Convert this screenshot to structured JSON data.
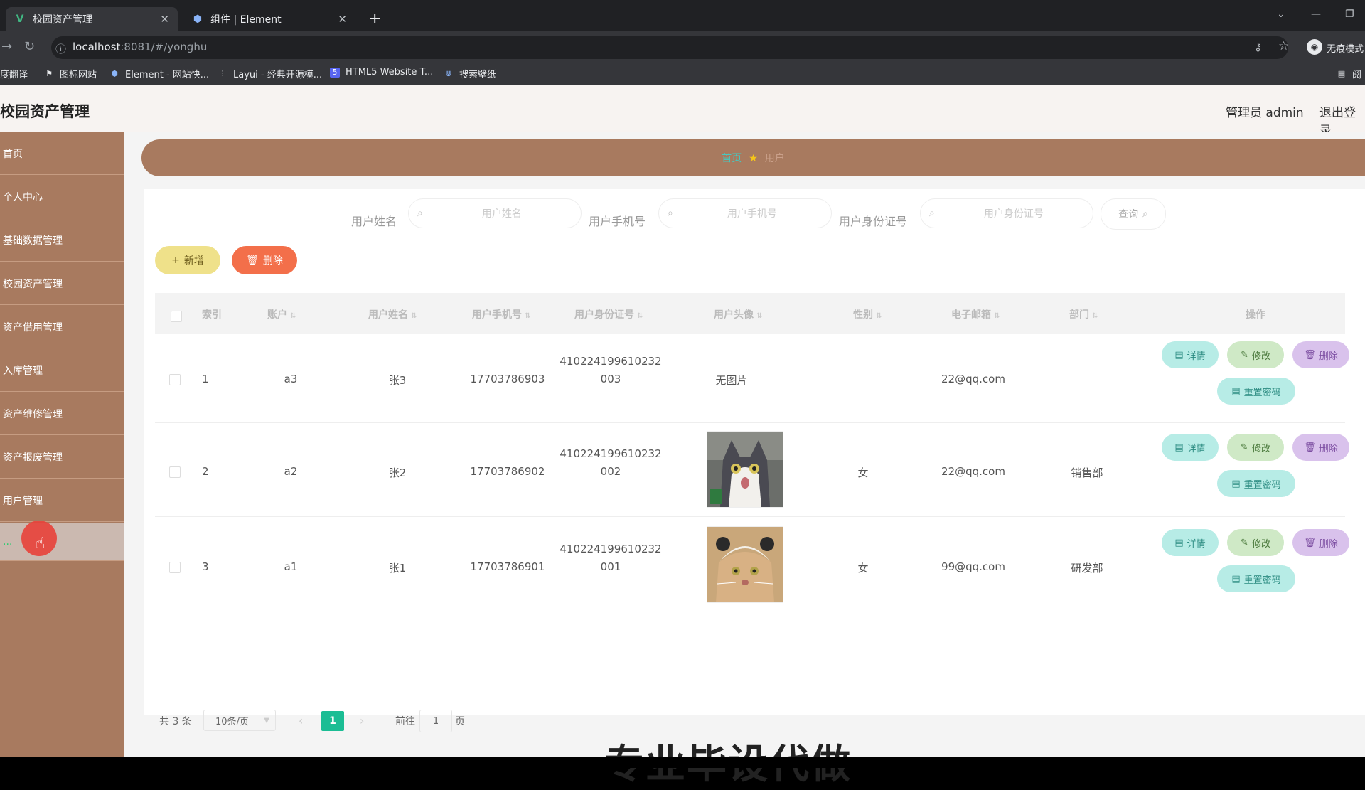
{
  "browser": {
    "tabs": [
      {
        "title": "校园资产管理",
        "favicon": "vue-icon",
        "active": true
      },
      {
        "title": "组件 | Element",
        "favicon": "element-icon",
        "active": false
      }
    ],
    "url_host": "localhost",
    "url_rest": ":8081/#/yonghu",
    "profile_label": "无痕模式",
    "bookmarks": [
      "度翻译",
      "图标网站",
      "Element - 网站快...",
      "Layui - 经典开源模...",
      "HTML5 Website T...",
      "搜索壁纸"
    ],
    "bookmarks_right": "阅"
  },
  "header": {
    "title": "校园资产管理",
    "user": "管理员 admin",
    "logout": "退出登录"
  },
  "sidebar": {
    "items": [
      "首页",
      "个人中心",
      "基础数据管理",
      "校园资产管理",
      "资产借用管理",
      "入库管理",
      "资产维修管理",
      "资产报废管理",
      "用户管理",
      "..."
    ]
  },
  "breadcrumb": {
    "home": "首页",
    "current": "用户"
  },
  "search": {
    "name_label": "用户姓名",
    "name_placeholder": "用户姓名",
    "phone_label": "用户手机号",
    "phone_placeholder": "用户手机号",
    "idcard_label": "用户身份证号",
    "idcard_placeholder": "用户身份证号",
    "query": "查询"
  },
  "actions": {
    "add": "新增",
    "delete": "删除"
  },
  "table": {
    "headers": {
      "index": "索引",
      "account": "账户",
      "name": "用户姓名",
      "phone": "用户手机号",
      "idcard": "用户身份证号",
      "avatar": "用户头像",
      "gender": "性别",
      "email": "电子邮箱",
      "dept": "部门",
      "ops": "操作"
    },
    "rows": [
      {
        "index": "1",
        "account": "a3",
        "name": "张3",
        "phone": "17703786903",
        "id1": "410224199610232",
        "id2": "003",
        "avatar_text": "无图片",
        "gender": "",
        "email": "22@qq.com",
        "dept": ""
      },
      {
        "index": "2",
        "account": "a2",
        "name": "张2",
        "phone": "17703786902",
        "id1": "410224199610232",
        "id2": "002",
        "avatar_text": "",
        "gender": "女",
        "email": "22@qq.com",
        "dept": "销售部"
      },
      {
        "index": "3",
        "account": "a1",
        "name": "张1",
        "phone": "17703786901",
        "id1": "410224199610232",
        "id2": "001",
        "avatar_text": "",
        "gender": "女",
        "email": "99@qq.com",
        "dept": "研发部"
      }
    ],
    "op_labels": {
      "detail": "详情",
      "edit": "修改",
      "delete": "删除",
      "reset": "重置密码"
    }
  },
  "pagination": {
    "total": "共 3 条",
    "page_size": "10条/页",
    "current": "1",
    "goto": "前往",
    "goto_value": "1",
    "page_unit": "页"
  },
  "overlay_text": "专业毕设代做"
}
